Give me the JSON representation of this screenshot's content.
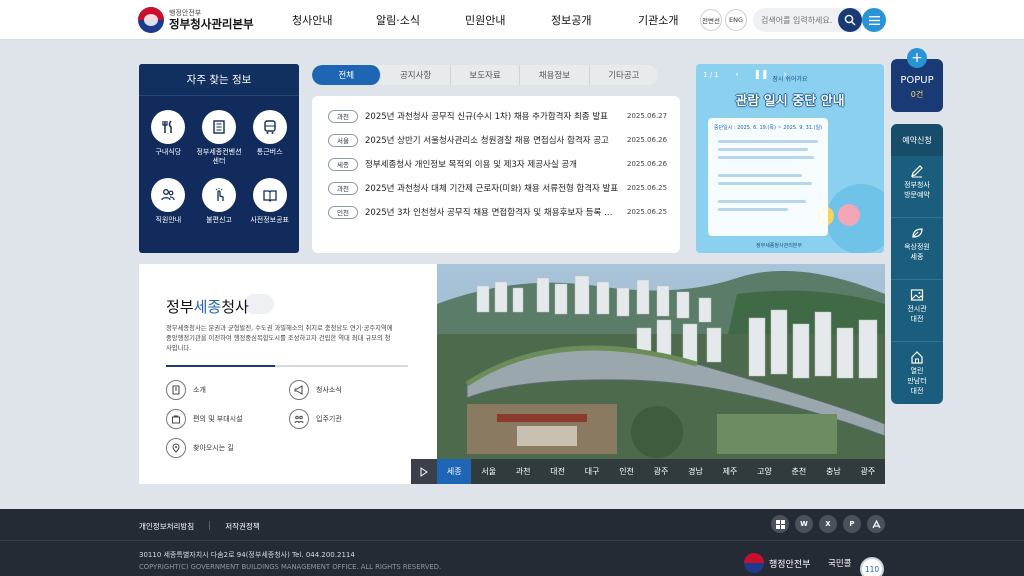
{
  "header": {
    "logo_small": "행정안전부",
    "logo_big": "정부청사관리본부",
    "nav": [
      "청사안내",
      "알림·소식",
      "민원안내",
      "정보공개",
      "기관소개"
    ],
    "lang_buttons": [
      "전변선",
      "ENG"
    ],
    "search_placeholder": "검색어를 입력하세요."
  },
  "faq": {
    "title": "자주 찾는 정보",
    "items": [
      "구내식당",
      "정부세종컨벤션센터",
      "통근버스",
      "직원안내",
      "불편신고",
      "사전정보공표"
    ]
  },
  "news": {
    "tabs": [
      "전체",
      "공지사항",
      "보도자료",
      "채용정보",
      "기타공고"
    ],
    "items": [
      {
        "badge": "과천",
        "title": "2025년 과천청사 공무직 신규(수시 1차) 채용 추가합격자 최종 발표",
        "date": "2025.06.27"
      },
      {
        "badge": "서울",
        "title": "2025년 상반기 서울청사관리소 청원경찰 채용 면접심사 합격자 공고",
        "date": "2025.06.26"
      },
      {
        "badge": "세종",
        "title": "정부세종청사 개인정보 목적외 이용 및 제3자 제공사실 공개",
        "date": "2025.06.26"
      },
      {
        "badge": "과천",
        "title": "2025년 과천청사 대체 기간제 근로자(미화) 채용 서류전형 합격자 발표",
        "date": "2025.06.25"
      },
      {
        "badge": "인천",
        "title": "2025년 3차 인천청사 공무직 채용 면접합격자 및 채용후보자 등록 안내",
        "date": "2025.06.25"
      }
    ]
  },
  "banner": {
    "counter": "1 / 1",
    "subtitle": "잠시 쉬어가요",
    "headline": "관람 일시 중단 안내",
    "date_text": "중단일시 : 2025. 6. 19.(목) ~ 2025. 9. 31.(일)",
    "footer": "정부세종청사관리본부"
  },
  "popup": {
    "title": "POPUP",
    "count": "0건"
  },
  "reservation": {
    "title": "예약신청",
    "items": [
      "정부청사\n방문예약",
      "옥상정원\n세종",
      "전시관\n대전",
      "열린\n만남터\n대전"
    ]
  },
  "sejong": {
    "title_pre": "정부",
    "title_hl": "세종",
    "title_post": "청사",
    "description": "정부세종청사는 분권과 균형발전, 수도권 과밀해소의 취지로 충청남도 연기·공주지역에 중앙행정기관을 이전하여 행정중심복합도시를 조성하고자 건립한 역대 최대 규모의 청사입니다.",
    "links": [
      "소개",
      "청사소식",
      "편의 및 부대시설",
      "입주기관",
      "찾아오시는 길"
    ]
  },
  "regions": [
    "세종",
    "서울",
    "과천",
    "대전",
    "대구",
    "인천",
    "광주",
    "경남",
    "제주",
    "고양",
    "춘천",
    "충남",
    "광주"
  ],
  "footer": {
    "links": [
      "개인정보처리방침",
      "저작권정책"
    ],
    "address": "30110 세종특별자치시 다솜2로 94(정부세종청사) Tel. 044.200.2114",
    "copyright": "COPYRIGHT(C) GOVERNMENT BUILDINGS MANAGEMENT OFFICE. ALL RIGHTS RESERVED.",
    "moi": "행정안전부",
    "kukmin": "국민콜",
    "call": "110",
    "file_icons": [
      "HWP",
      "W",
      "X",
      "P",
      "PDF"
    ]
  },
  "colors": {
    "navy": "#102b5c",
    "accent_blue": "#1e66b4",
    "teal": "#1b5d7d",
    "footer_bg": "#252b35"
  }
}
